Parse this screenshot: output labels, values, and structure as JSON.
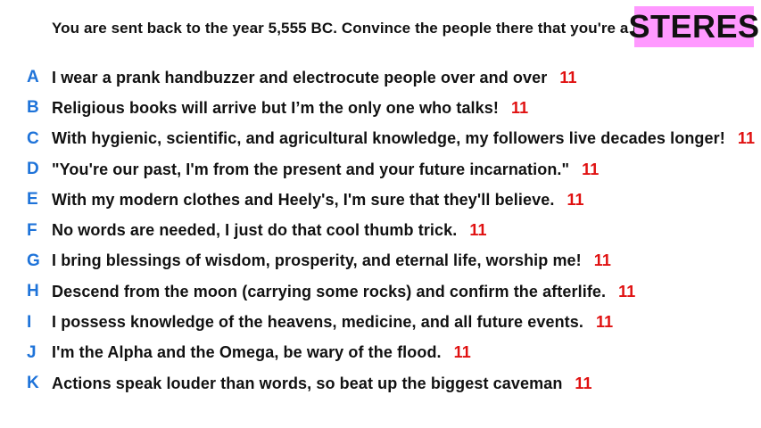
{
  "question": {
    "text": "You are sent back to the year 5,555 BC. Convince the people there that you're a god."
  },
  "brand": {
    "label": "STERES",
    "background_color": "#ff99ff"
  },
  "colors": {
    "letter": "#1e73d9",
    "score": "#e01010",
    "text": "#111111"
  },
  "answers": [
    {
      "letter": "A",
      "text": "I wear a prank handbuzzer and electrocute people over and over",
      "score": "11"
    },
    {
      "letter": "B",
      "text": "Religious books will arrive but I’m the only one who talks!",
      "score": "11"
    },
    {
      "letter": "C",
      "text": "With hygienic, scientific, and agricultural knowledge, my followers live decades longer!",
      "score": "11"
    },
    {
      "letter": "D",
      "text": "\"You're our past, I'm from the present and your future incarnation.\"",
      "score": "11"
    },
    {
      "letter": "E",
      "text": "With my modern clothes and Heely's, I'm sure that they'll believe.",
      "score": "11"
    },
    {
      "letter": "F",
      "text": "No words are needed, I just do that cool thumb trick.",
      "score": "11"
    },
    {
      "letter": "G",
      "text": "I bring blessings of wisdom, prosperity, and eternal life, worship me!",
      "score": "11"
    },
    {
      "letter": "H",
      "text": "Descend from the moon (carrying some rocks) and confirm the afterlife.",
      "score": "11"
    },
    {
      "letter": "I",
      "text": "I possess knowledge of the heavens, medicine, and all future events.",
      "score": "11"
    },
    {
      "letter": "J",
      "text": "I'm the Alpha and the Omega, be wary of the flood.",
      "score": "11"
    },
    {
      "letter": "K",
      "text": "Actions speak louder than words, so beat up the biggest caveman",
      "score": "11"
    }
  ]
}
